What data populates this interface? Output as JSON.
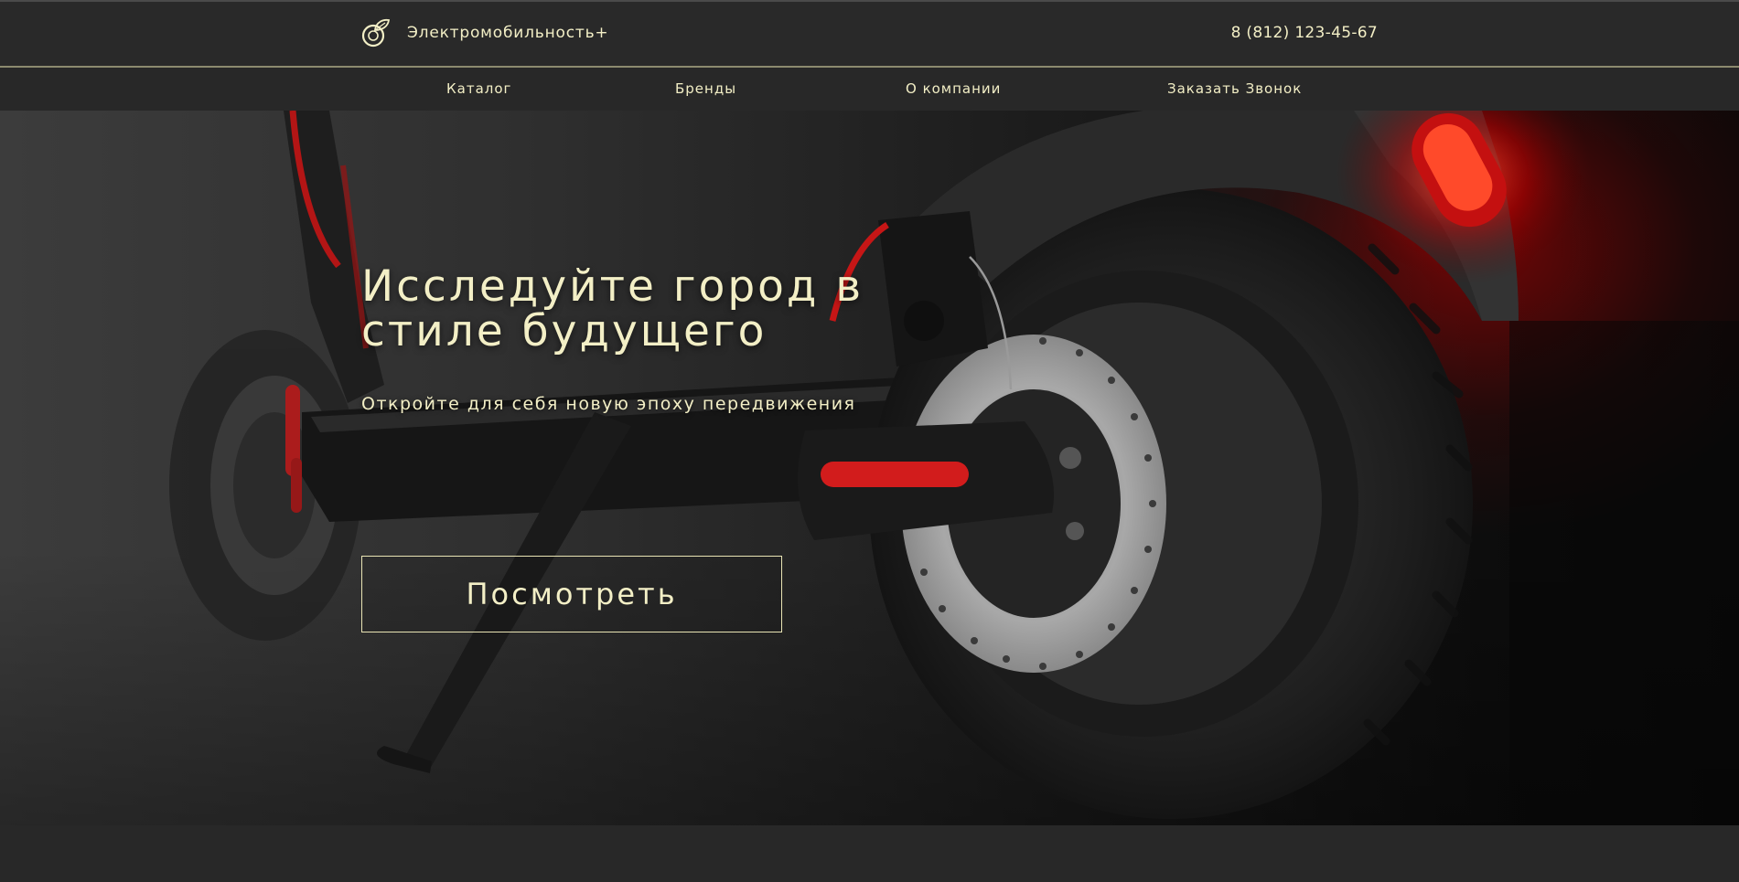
{
  "header": {
    "brand_name": "Электромобильность+",
    "logo_icon": "leaf-ring-icon",
    "phone": "8 (812) 123-45-67"
  },
  "nav": {
    "items": [
      {
        "label": "Каталог"
      },
      {
        "label": "Бренды"
      },
      {
        "label": "О компании"
      },
      {
        "label": "Заказать Звонок"
      }
    ]
  },
  "hero": {
    "title": "Исследуйте город в стиле будущего",
    "subtitle": "Откройте для себя новую эпоху передвижения",
    "cta_label": "Посмотреть",
    "image_subject": "electric scooter rear wheel with disc brake and red tail light"
  },
  "colors": {
    "text_accent": "#f3efc6",
    "background": "#272727",
    "tail_light": "#e21a1a"
  }
}
